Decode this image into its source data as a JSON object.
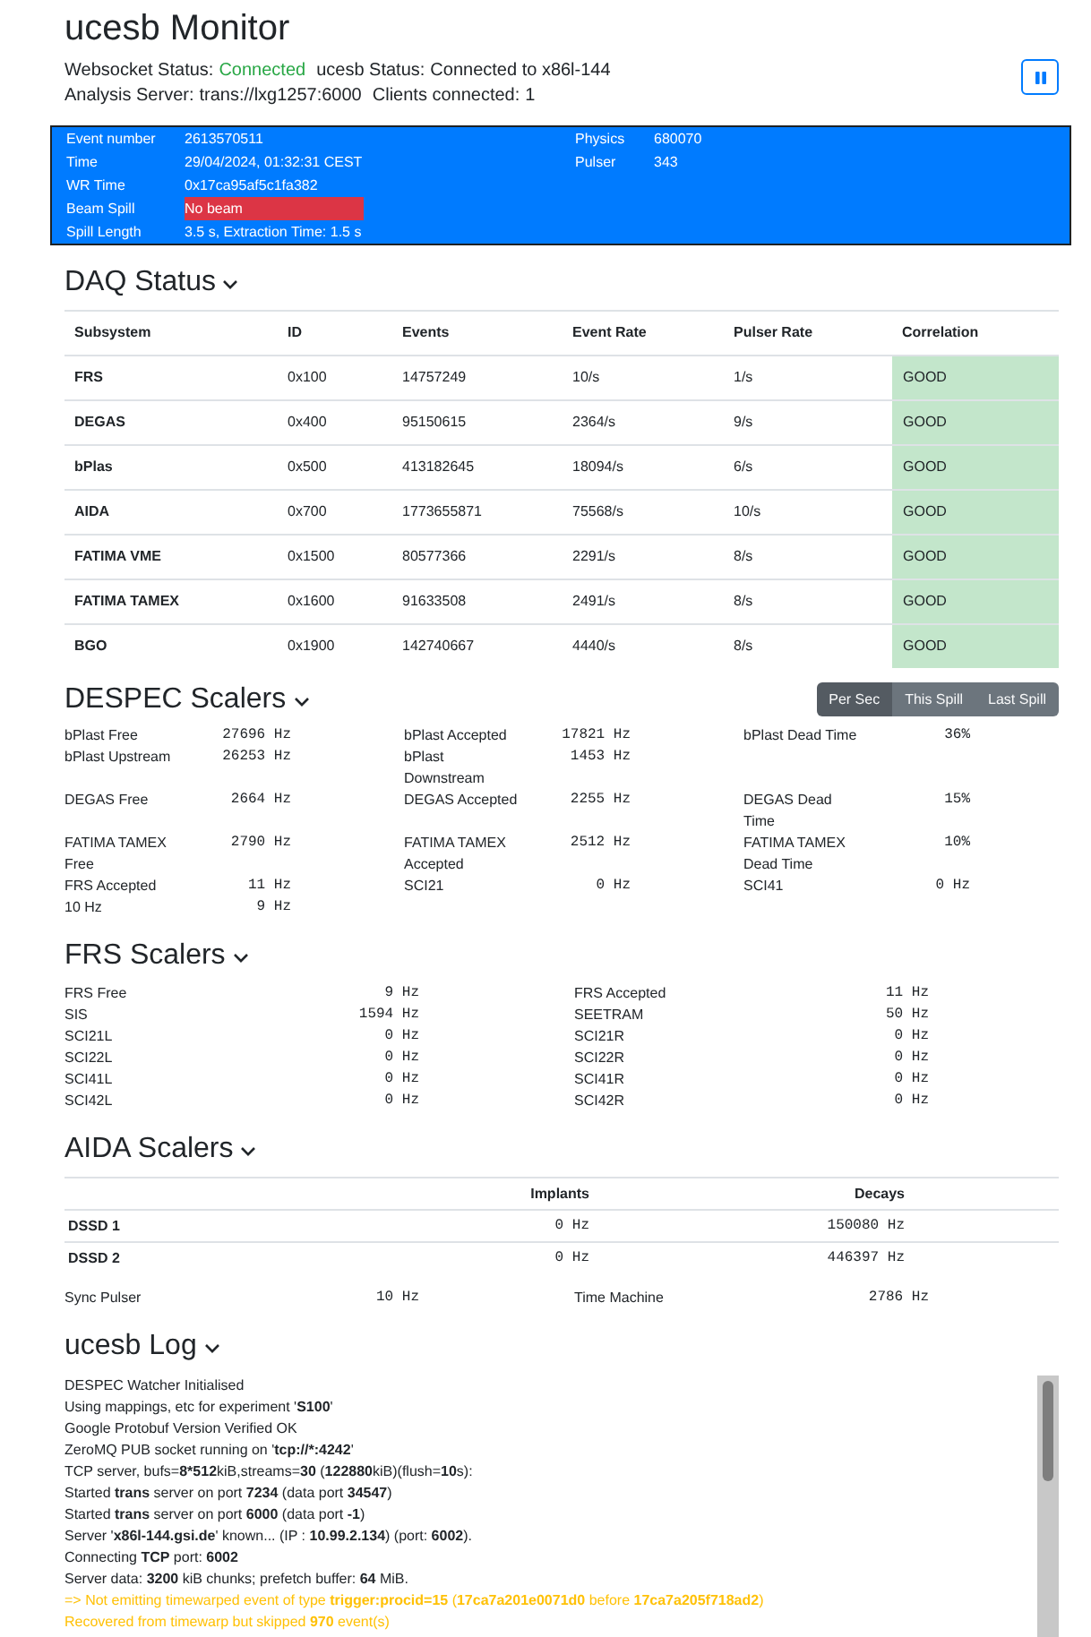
{
  "title": "ucesb Monitor",
  "websocket_status": {
    "label": "Websocket Status:",
    "value": "Connected",
    "connected": true
  },
  "ucesb_status": {
    "label": "ucesb Status:",
    "value": "Connected to x86l-144"
  },
  "analysis_server": {
    "label": "Analysis Server:",
    "value": "trans://lxg1257:6000"
  },
  "clients": {
    "label": "Clients connected:",
    "value": "1"
  },
  "event_panel": {
    "left": [
      {
        "label": "Event number",
        "value": "2613570511",
        "alert": false
      },
      {
        "label": "Time",
        "value": "29/04/2024, 01:32:31 CEST",
        "alert": false
      },
      {
        "label": "WR Time",
        "value": "0x17ca95af5c1fa382",
        "alert": false
      },
      {
        "label": "Beam Spill",
        "value": "No beam",
        "alert": true
      },
      {
        "label": "Spill Length",
        "value": "3.5 s, Extraction Time: 1.5 s",
        "alert": false
      }
    ],
    "right": [
      {
        "label": "Physics",
        "value": "680070"
      },
      {
        "label": "Pulser",
        "value": "343"
      }
    ]
  },
  "daq_status": {
    "title": "DAQ Status",
    "columns": [
      "Subsystem",
      "ID",
      "Events",
      "Event Rate",
      "Pulser Rate"
    ],
    "correlation_column": "Correlation",
    "rows": [
      {
        "cells": [
          "FRS",
          "0x100",
          "14757249",
          "10/s",
          "1/s"
        ],
        "correlation": "GOOD",
        "good": true
      },
      {
        "cells": [
          "DEGAS",
          "0x400",
          "95150615",
          "2364/s",
          "9/s"
        ],
        "correlation": "GOOD",
        "good": true
      },
      {
        "cells": [
          "bPlas",
          "0x500",
          "413182645",
          "18094/s",
          "6/s"
        ],
        "correlation": "GOOD",
        "good": true
      },
      {
        "cells": [
          "AIDA",
          "0x700",
          "1773655871",
          "75568/s",
          "10/s"
        ],
        "correlation": "GOOD",
        "good": true
      },
      {
        "cells": [
          "FATIMA VME",
          "0x1500",
          "80577366",
          "2291/s",
          "8/s"
        ],
        "correlation": "GOOD",
        "good": true
      },
      {
        "cells": [
          "FATIMA TAMEX",
          "0x1600",
          "91633508",
          "2491/s",
          "8/s"
        ],
        "correlation": "GOOD",
        "good": true
      },
      {
        "cells": [
          "BGO",
          "0x1900",
          "142740667",
          "4440/s",
          "8/s"
        ],
        "correlation": "GOOD",
        "good": true
      }
    ]
  },
  "despec_scalers": {
    "title": "DESPEC Scalers",
    "modes": [
      {
        "label": "Per Sec",
        "selected": true
      },
      {
        "label": "This Spill",
        "selected": false
      },
      {
        "label": "Last Spill",
        "selected": false
      }
    ],
    "rows": [
      [
        {
          "label": "bPlast Free",
          "value": "27696 Hz"
        },
        {
          "label": "bPlast Accepted",
          "value": "17821 Hz"
        },
        {
          "label": "bPlast Dead Time",
          "value": "36%"
        }
      ],
      [
        {
          "label": "bPlast Upstream",
          "value": "26253 Hz"
        },
        {
          "label": "bPlast Downstream",
          "value": "1453 Hz"
        }
      ],
      [
        {
          "label": "DEGAS Free",
          "value": "2664 Hz"
        },
        {
          "label": "DEGAS Accepted",
          "value": "2255 Hz"
        },
        {
          "label": "DEGAS Dead Time",
          "value": "15%"
        }
      ],
      [
        {
          "label": "FATIMA TAMEX Free",
          "value": "2790 Hz"
        },
        {
          "label": "FATIMA TAMEX Accepted",
          "value": "2512 Hz"
        },
        {
          "label": "FATIMA TAMEX Dead Time",
          "value": "10%"
        }
      ],
      [
        {
          "label": "FRS Accepted",
          "value": "11 Hz"
        },
        {
          "label": "SCI21",
          "value": "0 Hz"
        },
        {
          "label": "SCI41",
          "value": "0 Hz"
        }
      ],
      [
        {
          "label": "10 Hz",
          "value": "9 Hz"
        }
      ]
    ]
  },
  "frs_scalers": {
    "title": "FRS Scalers",
    "rows": [
      [
        {
          "label": "FRS Free",
          "value": "9 Hz"
        },
        {
          "label": "FRS Accepted",
          "value": "11 Hz"
        }
      ],
      [
        {
          "label": "SIS",
          "value": "1594 Hz"
        },
        {
          "label": "SEETRAM",
          "value": "50 Hz"
        }
      ],
      [
        {
          "label": "SCI21L",
          "value": "0 Hz"
        },
        {
          "label": "SCI21R",
          "value": "0 Hz"
        }
      ],
      [
        {
          "label": "SCI22L",
          "value": "0 Hz"
        },
        {
          "label": "SCI22R",
          "value": "0 Hz"
        }
      ],
      [
        {
          "label": "SCI41L",
          "value": "0 Hz"
        },
        {
          "label": "SCI41R",
          "value": "0 Hz"
        }
      ],
      [
        {
          "label": "SCI42L",
          "value": "0 Hz"
        },
        {
          "label": "SCI42R",
          "value": "0 Hz"
        }
      ]
    ]
  },
  "aida_scalers": {
    "title": "AIDA Scalers",
    "columns": [
      "Implants",
      "Decays"
    ],
    "rows": [
      {
        "name": "DSSD 1",
        "implants": "0 Hz",
        "decays": "150080 Hz"
      },
      {
        "name": "DSSD 2",
        "implants": "0 Hz",
        "decays": "446397 Hz"
      }
    ],
    "extras": [
      {
        "label": "Sync Pulser",
        "value": "10 Hz"
      },
      {
        "label": "Time Machine",
        "value": "2786 Hz"
      }
    ]
  },
  "ucesb_log": {
    "title": "ucesb Log",
    "lines": [
      {
        "kind": "info",
        "text": "DESPEC Watcher Initialised"
      },
      {
        "kind": "info",
        "text": "Using mappings, etc for experiment '**S100**'"
      },
      {
        "kind": "info",
        "text": "Google Protobuf Version Verified OK"
      },
      {
        "kind": "info",
        "text": "ZeroMQ PUB socket running on '**tcp://*:4242**'"
      },
      {
        "kind": "info",
        "text": "TCP server, bufs=**8*512**kiB,streams=**30** (**122880**kiB)(flush=**10**s):"
      },
      {
        "kind": "info",
        "text": "Started **trans** server on port **7234** (data port **34547**)"
      },
      {
        "kind": "info",
        "text": "Started **trans** server on port **6000** (data port **-1**)"
      },
      {
        "kind": "info",
        "text": "Server '**x86l-144.gsi.de**' known... (IP : **10.99.2.134**) (port: **6002**)."
      },
      {
        "kind": "info",
        "text": "Connecting **TCP** port: **6002**"
      },
      {
        "kind": "info",
        "text": "Server data: **3200** kiB chunks; prefetch buffer: **64** MiB."
      },
      {
        "kind": "warning",
        "text": "=> Not emitting timewarped event of type **trigger:procid=15** (**17ca7a201e0071d0** before **17ca7a205f718ad2**)"
      },
      {
        "kind": "warning",
        "text": "Recovered from timewarp but skipped **970** event(s)"
      }
    ]
  }
}
